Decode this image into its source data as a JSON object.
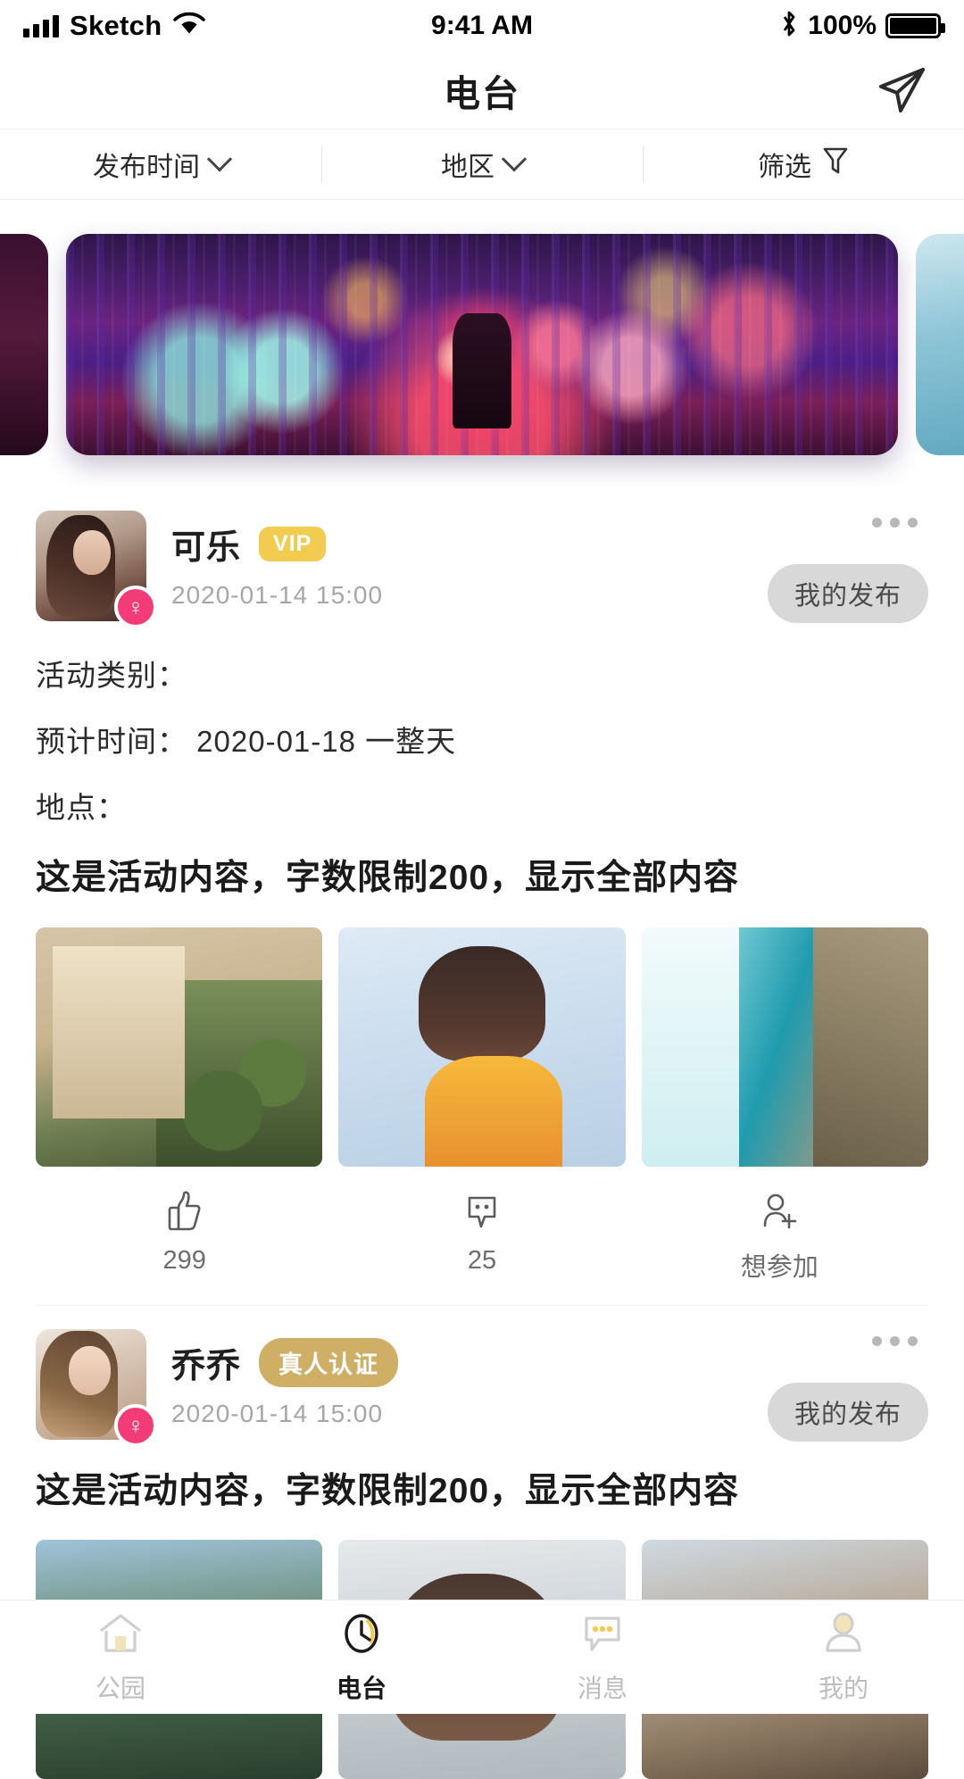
{
  "status_bar": {
    "carrier": "Sketch",
    "time": "9:41 AM",
    "battery_pct": "100%",
    "icons": {
      "signal": "signal-bars-icon",
      "wifi": "wifi-icon",
      "bluetooth": "bluetooth-icon",
      "battery": "battery-icon"
    }
  },
  "header": {
    "title": "电台",
    "action_icon": "send-plane-icon"
  },
  "filter_bar": {
    "items": [
      {
        "label": "发布时间",
        "icon": "chevron-down-icon"
      },
      {
        "label": "地区",
        "icon": "chevron-down-icon"
      },
      {
        "label": "筛选",
        "icon": "funnel-filter-icon"
      }
    ]
  },
  "carousel": {
    "slides": [
      {
        "name": "banner-prev",
        "alt": "暗紫色夜景插画"
      },
      {
        "name": "banner-active",
        "alt": "城市雨夜霓虹插画"
      },
      {
        "name": "banner-next",
        "alt": "浅蓝海景"
      }
    ],
    "active_index": 1
  },
  "posts": [
    {
      "user": "可乐",
      "badge": "VIP",
      "badge_type": "vip",
      "badge_color": "#F2CB51",
      "gender": "♀",
      "time": "2020-01-14  15:00",
      "owner_tag": "我的发布",
      "more_icon": "more-dots-icon",
      "info_lines": [
        "活动类别：",
        "预计时间： 2020-01-18 一整天",
        "地点："
      ],
      "content": "这是活动内容，字数限制200，显示全部内容",
      "images": [
        "建筑与棕榈树",
        "微笑的男孩",
        "海岸公路航拍"
      ],
      "actions": [
        {
          "icon": "thumbs-up-icon",
          "label": "299",
          "name": "like-action"
        },
        {
          "icon": "comment-bubble-icon",
          "label": "25",
          "name": "comment-action"
        },
        {
          "icon": "person-plus-icon",
          "label": "想参加",
          "name": "join-action"
        }
      ]
    },
    {
      "user": "乔乔",
      "badge": "真人认证",
      "badge_type": "real",
      "badge_color": "#CFAE66",
      "gender": "♀",
      "time": "2020-01-14  15:00",
      "owner_tag": "我的发布",
      "more_icon": "more-dots-icon",
      "info_lines": [],
      "content": "这是活动内容，字数限制200，显示全部内容",
      "images": [
        "湖畔山景",
        "女孩自拍",
        "城市街道"
      ],
      "actions": []
    }
  ],
  "tab_bar": {
    "items": [
      {
        "label": "公园",
        "icon": "home-icon",
        "active": false
      },
      {
        "label": "电台",
        "icon": "clock-radio-icon",
        "active": true
      },
      {
        "label": "消息",
        "icon": "message-bubble-icon",
        "active": false
      },
      {
        "label": "我的",
        "icon": "person-icon",
        "active": false
      }
    ]
  },
  "colors": {
    "accent": "#F2CB51",
    "gold": "#CFAE66",
    "pink": "#F23B77",
    "text": "#1A1A1A",
    "muted": "#A6A6A6"
  }
}
